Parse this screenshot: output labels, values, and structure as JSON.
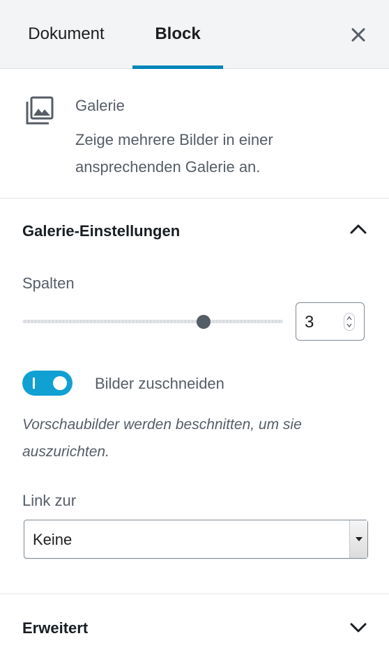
{
  "tabs": {
    "document": "Dokument",
    "block": "Block",
    "active": "Block"
  },
  "block": {
    "title": "Galerie",
    "description": "Zeige mehrere Bilder in einer ansprechenden Galerie an.",
    "icon": "gallery-icon"
  },
  "gallery_settings": {
    "title": "Galerie-Einstellungen",
    "expanded": true,
    "columns_label": "Spalten",
    "columns_value": "3",
    "columns_min": 1,
    "columns_max": 4,
    "crop_label": "Bilder zuschneiden",
    "crop_enabled": true,
    "crop_help": "Vorschaubilder werden beschnitten, um sie auszurichten.",
    "link_label": "Link zur",
    "link_value": "Keine"
  },
  "advanced": {
    "title": "Erweitert",
    "expanded": false
  },
  "colors": {
    "accent": "#0085ba",
    "toggle_on": "#11a0d2",
    "text_muted": "#555d66"
  }
}
